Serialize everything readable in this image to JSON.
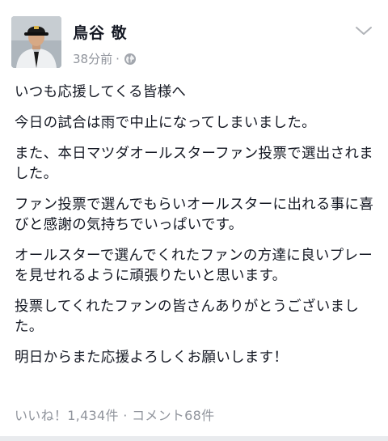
{
  "post": {
    "author": "鳥谷 敬",
    "timestamp": "38分前",
    "separator": "·",
    "privacy_icon": "globe-icon",
    "menu_icon": "chevron-down-icon",
    "paragraphs": [
      "いつも応援してくる皆様へ",
      "今日の試合は雨で中止になってしまいました。",
      "また、本日マツダオールスターファン投票で選出されました。",
      "ファン投票で選んでもらいオールスターに出れる事に喜びと感謝の気持ちでいっぱいです。",
      "オールスターで選んでくれたファンの方達に良いプレーを見せれるように頑張りたいと思います。",
      "投票してくれたファンの皆さんありがとうございました。",
      "明日からまた応援よろしくお願いします！"
    ],
    "likes": "いいね！1,434件",
    "stats_separator": "·",
    "comments": "コメント68件"
  },
  "colors": {
    "text": "#141823",
    "meta": "#90949c",
    "divider": "#e9ebee"
  }
}
